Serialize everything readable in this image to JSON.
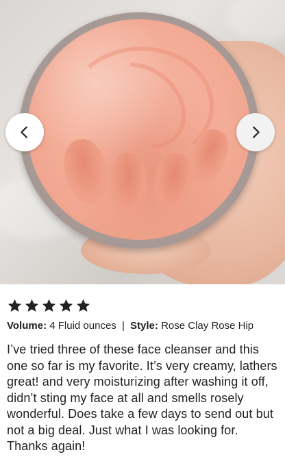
{
  "carousel": {
    "prev_icon": "chevron-left-icon",
    "next_icon": "chevron-right-icon",
    "image_colors": {
      "cream": "#f3ab95",
      "jar": "#a69894",
      "background": "#dcd9d6"
    }
  },
  "review": {
    "rating": 5,
    "max_rating": 5,
    "star_icon": "star-icon",
    "star_color": "#222222",
    "volume_key": "Volume:",
    "volume_value": "4 Fluid ounces",
    "separator": "|",
    "style_key": "Style:",
    "style_value": "Rose Clay Rose Hip",
    "text": "I’ve tried three of these face cleanser and this one so far is my favorite. It’s very creamy, lathers great! and very moisturizing after washing it off, didn’t sting my face at all and smells rosely wonderful. Does take a few days to send out but not a big deal. Just what I was looking for. Thanks again!"
  }
}
